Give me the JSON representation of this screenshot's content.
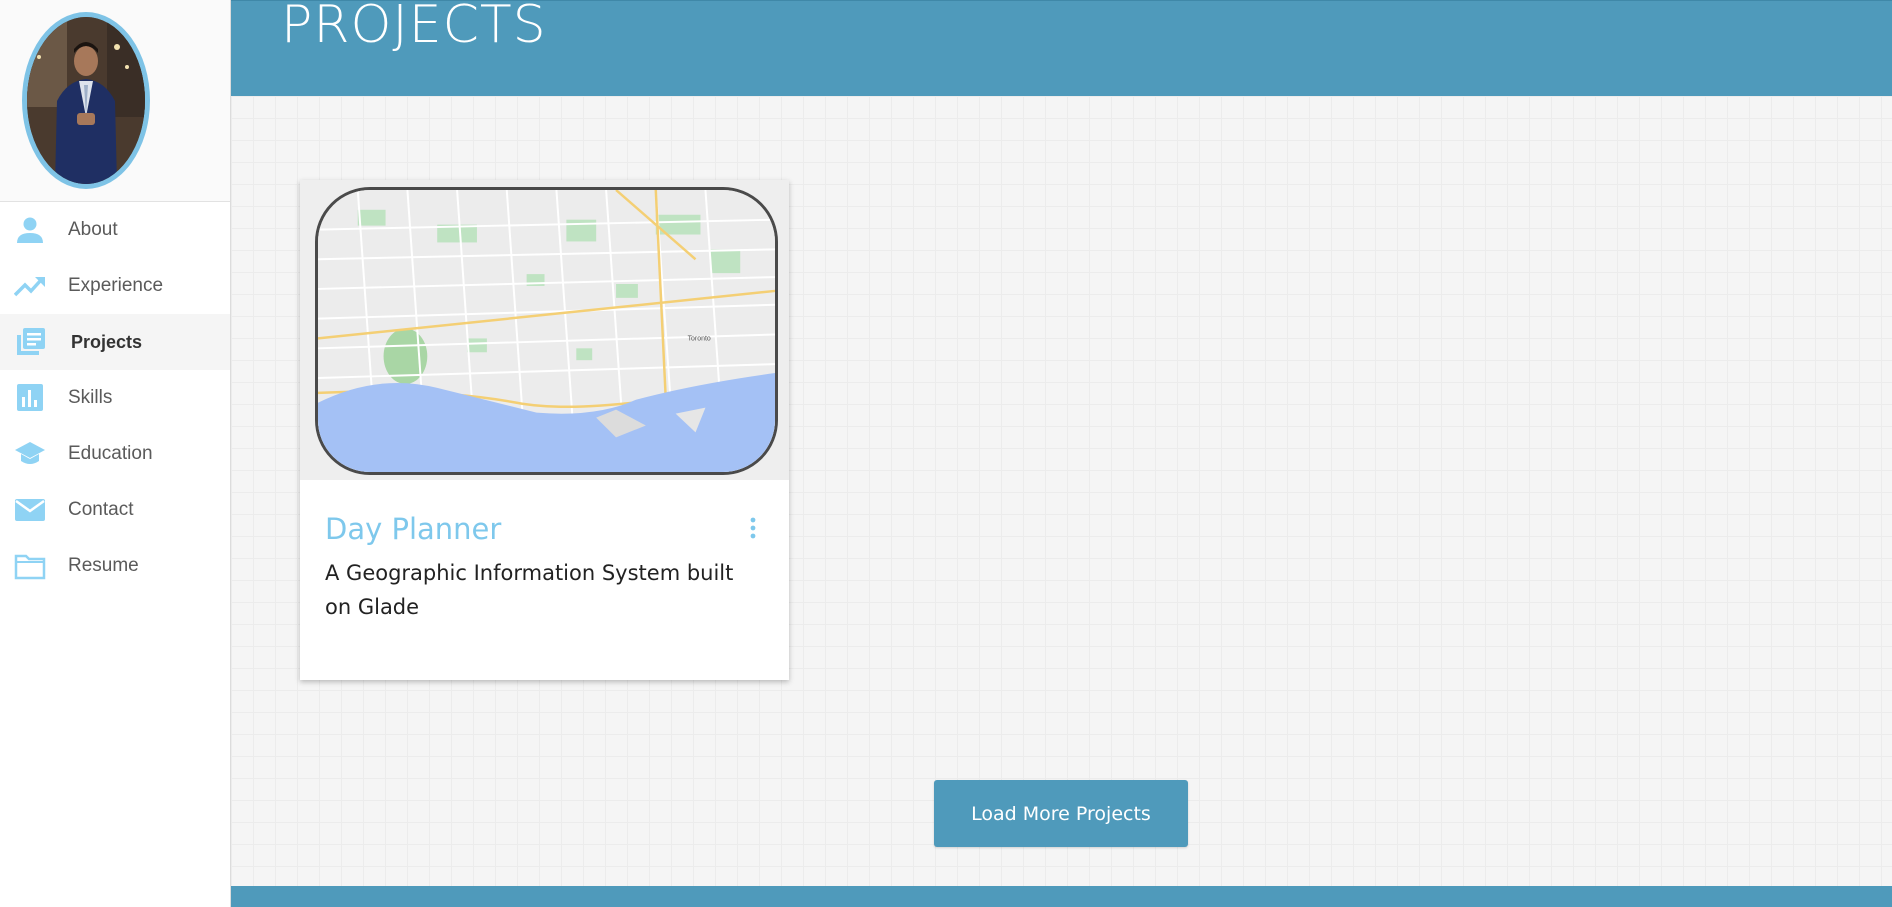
{
  "header": {
    "title": "PROJECTS"
  },
  "sidebar": {
    "items": [
      {
        "label": "About",
        "icon": "person-icon"
      },
      {
        "label": "Experience",
        "icon": "trending-up-icon"
      },
      {
        "label": "Projects",
        "icon": "library-books-icon",
        "active": true
      },
      {
        "label": "Skills",
        "icon": "bar-chart-icon"
      },
      {
        "label": "Education",
        "icon": "school-icon"
      },
      {
        "label": "Contact",
        "icon": "mail-icon"
      },
      {
        "label": "Resume",
        "icon": "folder-icon"
      }
    ]
  },
  "projects": [
    {
      "title": "Day Planner",
      "description": "A Geographic Information System built on Glade",
      "map_label": "Toronto"
    }
  ],
  "load_more_label": "Load More Projects",
  "colors": {
    "header": "#4f9abb",
    "accent": "#7ec8ec",
    "icon": "#8fd3f4",
    "button": "#4f9abb"
  }
}
